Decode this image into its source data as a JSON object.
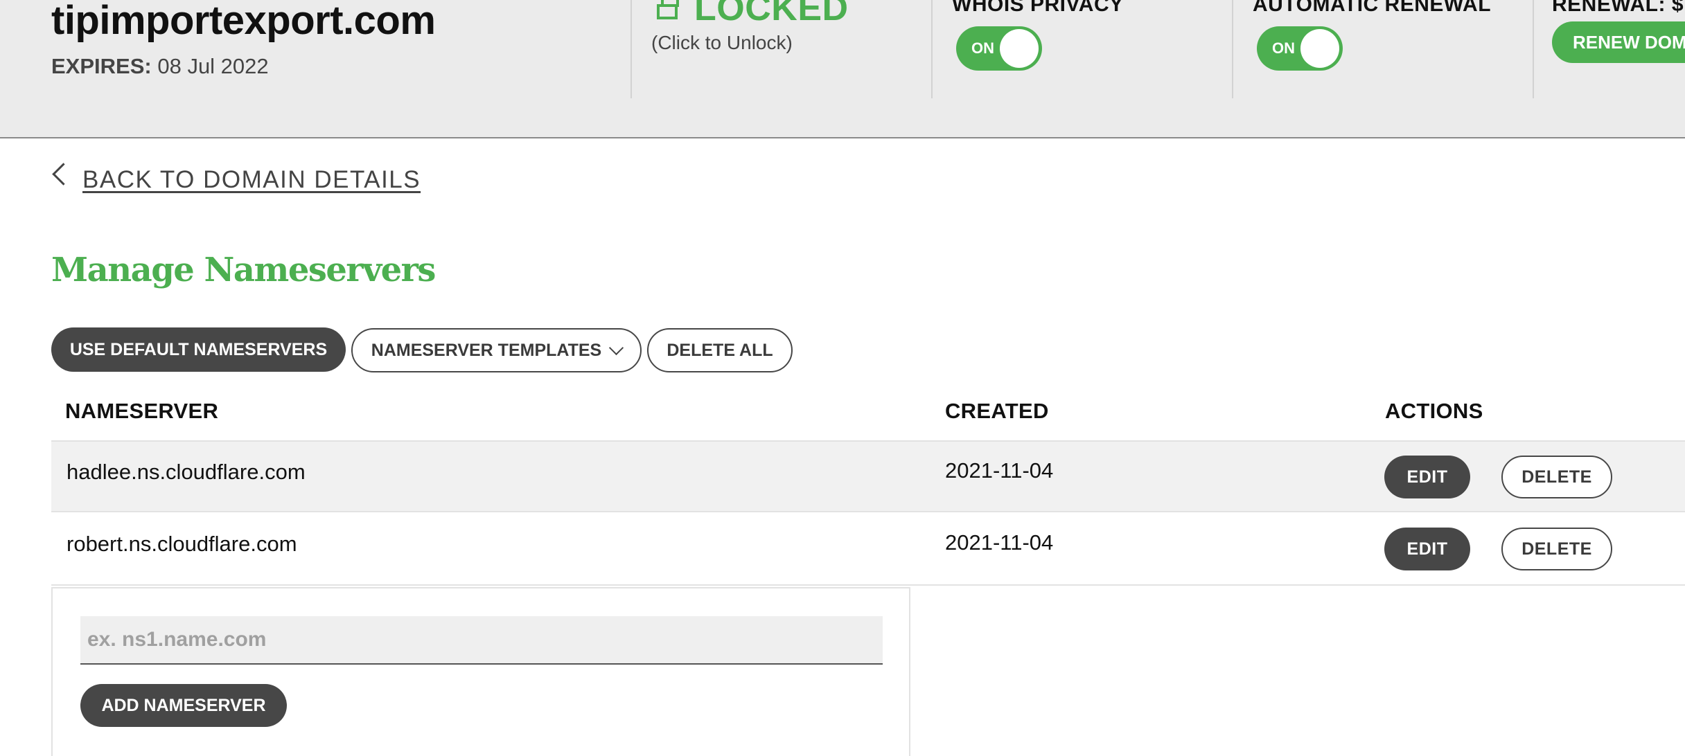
{
  "header": {
    "domain": "tipimportexport.com",
    "expires_label": "EXPIRES:",
    "expires_value": "08 Jul 2022",
    "lock": {
      "status": "LOCKED",
      "hint": "(Click to Unlock)"
    },
    "whois_privacy": {
      "label": "WHOIS PRIVACY",
      "state": "ON"
    },
    "auto_renewal": {
      "label": "AUTOMATIC RENEWAL",
      "state": "ON"
    },
    "renewal": {
      "label": "RENEWAL: $",
      "button": "RENEW DOMAIN"
    },
    "colors": {
      "accent": "#4caf50",
      "bar": "#ebebeb"
    }
  },
  "nav": {
    "back_label": "BACK TO DOMAIN DETAILS"
  },
  "page": {
    "title": "Manage Nameservers"
  },
  "toolbar": {
    "use_default": "USE DEFAULT NAMESERVERS",
    "templates": "NAMESERVER TEMPLATES",
    "delete_all": "DELETE ALL"
  },
  "table": {
    "columns": [
      "NAMESERVER",
      "CREATED",
      "ACTIONS"
    ],
    "rows": [
      {
        "nameserver": "hadlee.ns.cloudflare.com",
        "created": "2021-11-04",
        "edit": "EDIT",
        "delete": "DELETE"
      },
      {
        "nameserver": "robert.ns.cloudflare.com",
        "created": "2021-11-04",
        "edit": "EDIT",
        "delete": "DELETE"
      }
    ]
  },
  "add_form": {
    "placeholder": "ex. ns1.name.com",
    "value": "",
    "button": "ADD NAMESERVER"
  }
}
